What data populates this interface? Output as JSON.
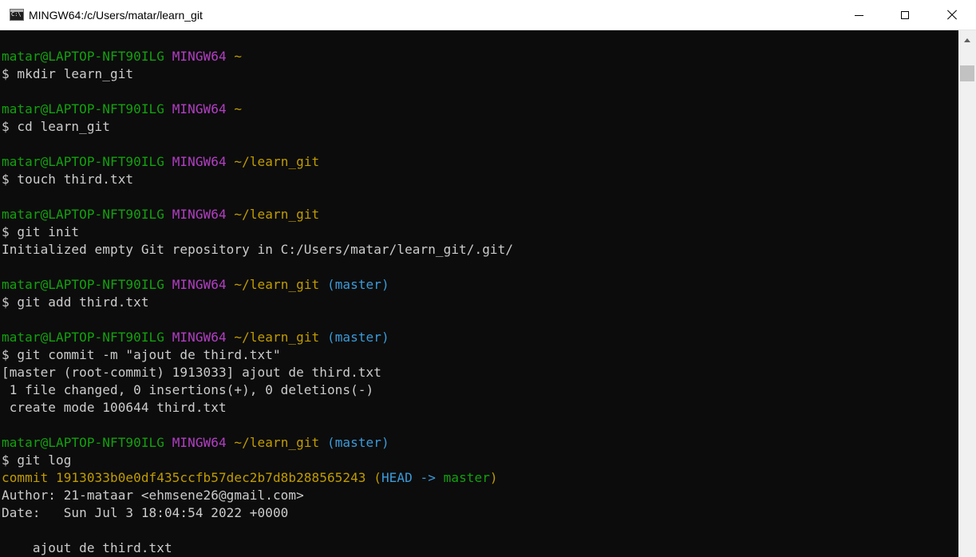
{
  "window": {
    "title": "MINGW64:/c/Users/matar/learn_git",
    "icon": "console-icon",
    "controls": [
      "minimize-icon",
      "maximize-icon",
      "close-icon"
    ]
  },
  "colors": {
    "background": "#0c0c0c",
    "text": "#cccccc",
    "user_host": "#13a10e",
    "mingw": "#b33ec4",
    "path": "#c19c00",
    "branch": "#3b9bd8"
  },
  "scrollbar": {
    "position_fraction": 0.0
  },
  "terminal_lines": [
    [
      {
        "t": "matar@LAPTOP-NFT90ILG",
        "c": "green"
      },
      {
        "t": " ",
        "c": "white"
      },
      {
        "t": "MINGW64",
        "c": "purple"
      },
      {
        "t": " ",
        "c": "white"
      },
      {
        "t": "~",
        "c": "yellow"
      }
    ],
    [
      {
        "t": "$ mkdir learn_git",
        "c": "white"
      }
    ],
    [],
    [
      {
        "t": "matar@LAPTOP-NFT90ILG",
        "c": "green"
      },
      {
        "t": " ",
        "c": "white"
      },
      {
        "t": "MINGW64",
        "c": "purple"
      },
      {
        "t": " ",
        "c": "white"
      },
      {
        "t": "~",
        "c": "yellow"
      }
    ],
    [
      {
        "t": "$ cd learn_git",
        "c": "white"
      }
    ],
    [],
    [
      {
        "t": "matar@LAPTOP-NFT90ILG",
        "c": "green"
      },
      {
        "t": " ",
        "c": "white"
      },
      {
        "t": "MINGW64",
        "c": "purple"
      },
      {
        "t": " ",
        "c": "white"
      },
      {
        "t": "~/learn_git",
        "c": "yellow"
      }
    ],
    [
      {
        "t": "$ touch third.txt",
        "c": "white"
      }
    ],
    [],
    [
      {
        "t": "matar@LAPTOP-NFT90ILG",
        "c": "green"
      },
      {
        "t": " ",
        "c": "white"
      },
      {
        "t": "MINGW64",
        "c": "purple"
      },
      {
        "t": " ",
        "c": "white"
      },
      {
        "t": "~/learn_git",
        "c": "yellow"
      }
    ],
    [
      {
        "t": "$ git init",
        "c": "white"
      }
    ],
    [
      {
        "t": "Initialized empty Git repository in C:/Users/matar/learn_git/.git/",
        "c": "white"
      }
    ],
    [],
    [
      {
        "t": "matar@LAPTOP-NFT90ILG",
        "c": "green"
      },
      {
        "t": " ",
        "c": "white"
      },
      {
        "t": "MINGW64",
        "c": "purple"
      },
      {
        "t": " ",
        "c": "white"
      },
      {
        "t": "~/learn_git",
        "c": "yellow"
      },
      {
        "t": " ",
        "c": "white"
      },
      {
        "t": "(master)",
        "c": "cyan"
      }
    ],
    [
      {
        "t": "$ git add third.txt",
        "c": "white"
      }
    ],
    [],
    [
      {
        "t": "matar@LAPTOP-NFT90ILG",
        "c": "green"
      },
      {
        "t": " ",
        "c": "white"
      },
      {
        "t": "MINGW64",
        "c": "purple"
      },
      {
        "t": " ",
        "c": "white"
      },
      {
        "t": "~/learn_git",
        "c": "yellow"
      },
      {
        "t": " ",
        "c": "white"
      },
      {
        "t": "(master)",
        "c": "cyan"
      }
    ],
    [
      {
        "t": "$ git commit -m \"ajout de third.txt\"",
        "c": "white"
      }
    ],
    [
      {
        "t": "[master (root-commit) 1913033] ajout de third.txt",
        "c": "white"
      }
    ],
    [
      {
        "t": " 1 file changed, 0 insertions(+), 0 deletions(-)",
        "c": "white"
      }
    ],
    [
      {
        "t": " create mode 100644 third.txt",
        "c": "white"
      }
    ],
    [],
    [
      {
        "t": "matar@LAPTOP-NFT90ILG",
        "c": "green"
      },
      {
        "t": " ",
        "c": "white"
      },
      {
        "t": "MINGW64",
        "c": "purple"
      },
      {
        "t": " ",
        "c": "white"
      },
      {
        "t": "~/learn_git",
        "c": "yellow"
      },
      {
        "t": " ",
        "c": "white"
      },
      {
        "t": "(master)",
        "c": "cyan"
      }
    ],
    [
      {
        "t": "$ git log",
        "c": "white"
      }
    ],
    [
      {
        "t": "commit 1913033b0e0df435ccfb57dec2b7d8b288565243 ",
        "c": "yellow"
      },
      {
        "t": "(",
        "c": "yellow"
      },
      {
        "t": "HEAD -> ",
        "c": "cyan"
      },
      {
        "t": "master",
        "c": "green"
      },
      {
        "t": ")",
        "c": "yellow"
      }
    ],
    [
      {
        "t": "Author: 21-mataar <ehmsene26@gmail.com>",
        "c": "white"
      }
    ],
    [
      {
        "t": "Date:   Sun Jul 3 18:04:54 2022 +0000",
        "c": "white"
      }
    ],
    [],
    [
      {
        "t": "    ajout de third.txt",
        "c": "white"
      }
    ]
  ]
}
